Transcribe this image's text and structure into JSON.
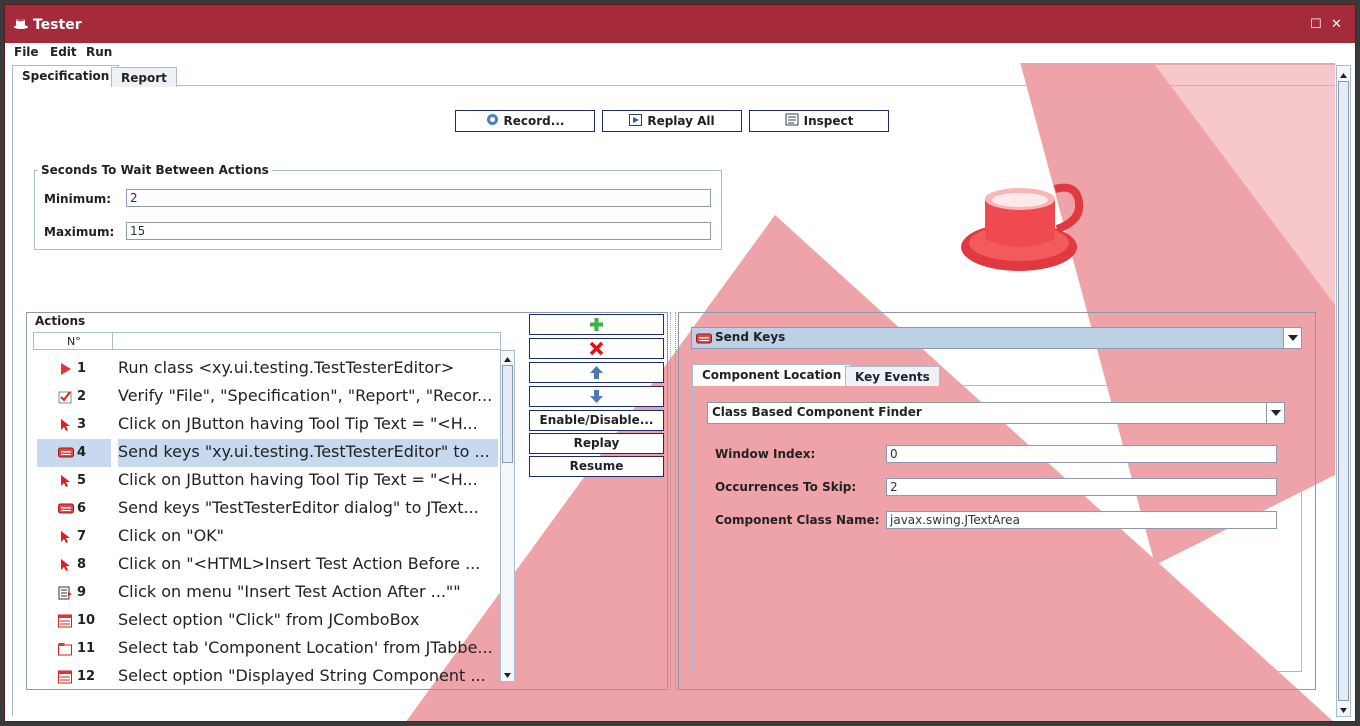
{
  "window": {
    "title": "Tester",
    "maximize_icon": "maximize-icon",
    "close_icon": "close-icon"
  },
  "menu": {
    "file": "File",
    "edit": "Edit",
    "run": "Run"
  },
  "tabs": {
    "specification": "Specification",
    "report": "Report"
  },
  "toolbar": {
    "record": "Record...",
    "replay_all": "Replay All",
    "inspect": "Inspect"
  },
  "wait_group": {
    "title": "Seconds To Wait Between Actions",
    "minimum_label": "Minimum:",
    "minimum_value": "2",
    "maximum_label": "Maximum:",
    "maximum_value": "15"
  },
  "actions": {
    "title": "Actions",
    "column_number": "N°",
    "column_description": "",
    "selected_index": 3,
    "rows": [
      {
        "num": "1",
        "icon": "run-class-icon",
        "text": "Run class <xy.ui.testing.TestTesterEditor>"
      },
      {
        "num": "2",
        "icon": "verify-check-icon",
        "text": "Verify \"File\", \"Specification\", \"Report\", \"Recor..."
      },
      {
        "num": "3",
        "icon": "cursor-arrow-icon",
        "text": "Click on JButton having  Tool Tip Text = \"<H..."
      },
      {
        "num": "4",
        "icon": "keyboard-icon",
        "text": "Send keys \"xy.ui.testing.TestTesterEditor\" to ..."
      },
      {
        "num": "5",
        "icon": "cursor-arrow-icon",
        "text": "Click on JButton having  Tool Tip Text = \"<H..."
      },
      {
        "num": "6",
        "icon": "keyboard-icon",
        "text": "Send keys \"TestTesterEditor dialog\" to JText..."
      },
      {
        "num": "7",
        "icon": "cursor-arrow-icon",
        "text": "Click on \"OK\""
      },
      {
        "num": "8",
        "icon": "cursor-arrow-icon",
        "text": "Click on \"<HTML>Insert Test Action Before ..."
      },
      {
        "num": "9",
        "icon": "menu-icon",
        "text": "Click on menu \"Insert Test Action After ...\"\""
      },
      {
        "num": "10",
        "icon": "combo-box-icon",
        "text": "Select option  \"Click\" from JComboBox"
      },
      {
        "num": "11",
        "icon": "tab-icon",
        "text": "Select tab 'Component Location' from JTabbe..."
      },
      {
        "num": "12",
        "icon": "combo-box-icon",
        "text": "Select option  \"Displayed String Component ..."
      }
    ]
  },
  "action_buttons": {
    "add_icon": "plus-icon",
    "remove_icon": "red-x-icon",
    "move_up_icon": "arrow-up-icon",
    "move_down_icon": "arrow-down-icon",
    "enable_disable": "Enable/Disable...",
    "replay": "Replay",
    "resume": "Resume"
  },
  "detail": {
    "action_type": "Send Keys",
    "tabs": {
      "component_location": "Component Location",
      "key_events": "Key Events"
    },
    "finder": "Class Based Component Finder",
    "window_index_label": "Window Index:",
    "window_index_value": "0",
    "occurrences_label": "Occurrences To Skip:",
    "occurrences_value": "2",
    "class_name_label": "Component Class Name:",
    "class_name_value": "javax.swing.JTextArea"
  },
  "colors": {
    "titlebar": "#a52a3a",
    "background_pink": "#eea3a8",
    "selection": "#c6d9ee",
    "accent_border": "#1e2b6e"
  }
}
